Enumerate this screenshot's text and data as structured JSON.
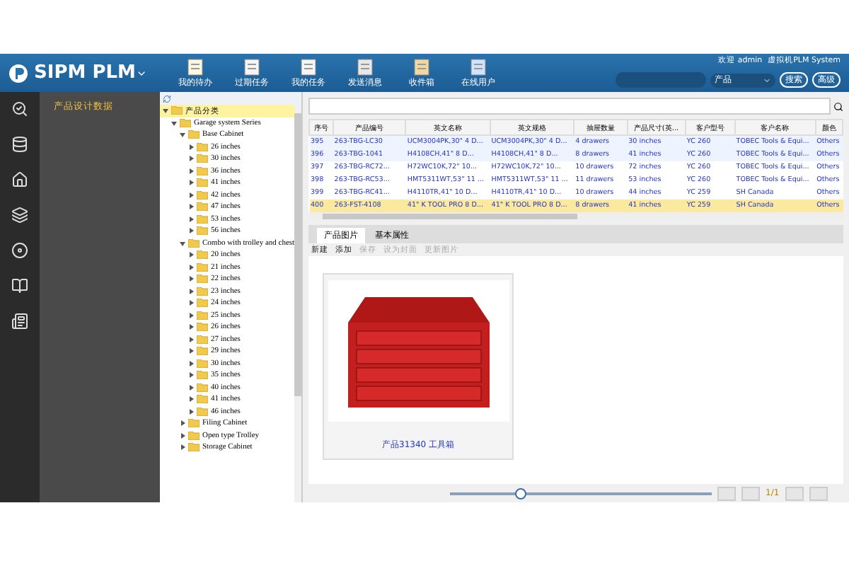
{
  "header": {
    "logo_text": "SIPM PLM",
    "tools": [
      {
        "label": "我的待办"
      },
      {
        "label": "过期任务"
      },
      {
        "label": "我的任务"
      },
      {
        "label": "发送消息"
      },
      {
        "label": "收件箱"
      },
      {
        "label": "在线用户"
      }
    ],
    "user_info": [
      "欢迎 admin",
      "虚拟机PLM System"
    ],
    "scope": "产品",
    "buttons": [
      "搜索",
      "高级"
    ]
  },
  "side_panel": {
    "items": [
      {
        "label": "产品设计数据",
        "selected": true
      }
    ]
  },
  "tree": {
    "nodes": [
      {
        "label": "产品分类",
        "expanded": true,
        "selected": true,
        "children": [
          {
            "label": "Garage system Series",
            "expanded": true,
            "selected": false,
            "children": [
              {
                "label": "Base Cabinet",
                "expanded": true,
                "selected": false,
                "children": [
                  {
                    "label": "26 inches",
                    "expanded": false,
                    "selected": false
                  },
                  {
                    "label": "30 inches",
                    "expanded": false,
                    "selected": false
                  },
                  {
                    "label": "36 inches",
                    "expanded": false,
                    "selected": false
                  },
                  {
                    "label": "41 inches",
                    "expanded": false,
                    "selected": false
                  },
                  {
                    "label": "42 inches",
                    "expanded": false,
                    "selected": false
                  },
                  {
                    "label": "47 inches",
                    "expanded": false,
                    "selected": false
                  },
                  {
                    "label": "53 inches",
                    "expanded": false,
                    "selected": false
                  },
                  {
                    "label": "56 inches",
                    "expanded": false,
                    "selected": false
                  }
                ]
              },
              {
                "label": "Combo with trolley and chest",
                "expanded": true,
                "selected": false,
                "children": [
                  {
                    "label": "20 inches",
                    "expanded": false,
                    "selected": false
                  },
                  {
                    "label": "21 inches",
                    "expanded": false,
                    "selected": false
                  },
                  {
                    "label": "22 inches",
                    "expanded": false,
                    "selected": false
                  },
                  {
                    "label": "23 inches",
                    "expanded": false,
                    "selected": false
                  },
                  {
                    "label": "24 inches",
                    "expanded": false,
                    "selected": false
                  },
                  {
                    "label": "25 inches",
                    "expanded": false,
                    "selected": false
                  },
                  {
                    "label": "26 inches",
                    "expanded": false,
                    "selected": false
                  },
                  {
                    "label": "27 inches",
                    "expanded": false,
                    "selected": false
                  },
                  {
                    "label": "29 inches",
                    "expanded": false,
                    "selected": false
                  },
                  {
                    "label": "30 inches",
                    "expanded": false,
                    "selected": false
                  },
                  {
                    "label": "35 inches",
                    "expanded": false,
                    "selected": false
                  },
                  {
                    "label": "40 inches",
                    "expanded": false,
                    "selected": false
                  },
                  {
                    "label": "41 inches",
                    "expanded": false,
                    "selected": false
                  },
                  {
                    "label": "46 inches",
                    "expanded": false,
                    "selected": false
                  }
                ]
              },
              {
                "label": "Filing Cabinet",
                "expanded": false,
                "selected": false
              },
              {
                "label": "Open type Trolley",
                "expanded": false,
                "selected": false
              },
              {
                "label": "Storage Cabinet",
                "expanded": false,
                "selected": false
              }
            ]
          }
        ]
      }
    ]
  },
  "table": {
    "columns": [
      "序号",
      "产品编号",
      "英文名称",
      "英文规格",
      "抽屉数量",
      "产品尺寸(英...",
      "客户型号",
      "客户名称",
      "颜色"
    ],
    "rows": [
      {
        "selected": false,
        "cells": [
          "395",
          "263-TBG-LC30",
          "UCM3004PK,30\" 4 D...",
          "UCM3004PK,30\" 4 D...",
          "4 drawers",
          "30 inches",
          "YC 260",
          "TOBEC Tools & Equi...",
          "Others"
        ]
      },
      {
        "selected": false,
        "cells": [
          "396",
          "263-TBG-1041",
          "H4108CH,41\" 8 D...",
          "H4108CH,41\" 8 D...",
          "8 drawers",
          "41 inches",
          "YC 260",
          "TOBEC Tools & Equi...",
          "Others"
        ]
      },
      {
        "selected": false,
        "cells": [
          "397",
          "263-TBG-RC72...",
          "H72WC10K,72\" 10...",
          "H72WC10K,72\" 10...",
          "10 drawers",
          "72 inches",
          "YC 260",
          "TOBEC Tools & Equi...",
          "Others"
        ]
      },
      {
        "selected": false,
        "cells": [
          "398",
          "263-TBG-RC53...",
          "HMT5311WT,53\" 11 ...",
          "HMT5311WT,53\" 11 ...",
          "11 drawers",
          "53 inches",
          "YC 260",
          "TOBEC Tools & Equi...",
          "Others"
        ]
      },
      {
        "selected": false,
        "cells": [
          "399",
          "263-TBG-RC41...",
          "H4110TR,41\" 10 D...",
          "H4110TR,41\" 10 D...",
          "10 drawers",
          "44 inches",
          "YC 259",
          "SH Canada",
          "Others"
        ]
      },
      {
        "selected": true,
        "cells": [
          "400",
          "263-FST-4108",
          "41\" K TOOL PRO 8 D...",
          "41\" K TOOL PRO 8 D...",
          "8 drawers",
          "41 inches",
          "YC 259",
          "SH Canada",
          "Others"
        ]
      }
    ]
  },
  "detail": {
    "tabs": [
      {
        "label": "产品图片",
        "selected": true
      },
      {
        "label": "基本属性",
        "selected": false
      }
    ],
    "toolbar": [
      {
        "label": "新建",
        "disabled": false
      },
      {
        "label": "添加",
        "disabled": false
      },
      {
        "label": "保存",
        "disabled": true
      },
      {
        "label": "设为封面",
        "disabled": true
      },
      {
        "label": "更新图片",
        "disabled": true
      }
    ],
    "images": [
      {
        "caption": "产品31340 工具箱"
      }
    ],
    "zoom": {
      "level": 0.27
    },
    "pager": "1/1"
  }
}
